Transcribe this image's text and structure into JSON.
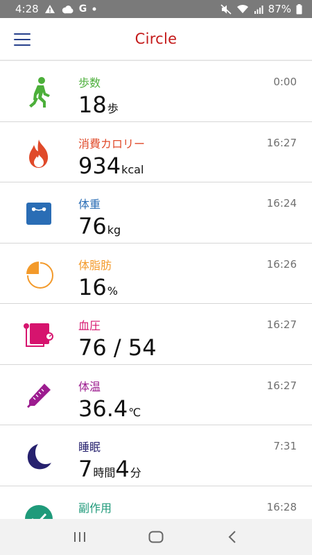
{
  "status_bar": {
    "time": "4:28",
    "battery": "87%",
    "left_icons": [
      "warning-icon",
      "cloud-icon",
      "g-icon",
      "dot-icon"
    ],
    "right_icons": [
      "mute-icon",
      "wifi-icon",
      "signal-icon",
      "battery-icon"
    ],
    "g_label": "G"
  },
  "app_bar": {
    "title": "Circle",
    "title_color": "#c41a1a",
    "menu_color": "#26408b"
  },
  "rows": [
    {
      "label": "歩数",
      "time": "0:00",
      "value": "18",
      "unit": "歩",
      "icon": "walking-person-icon",
      "color": "#4caf3a"
    },
    {
      "label": "消費カロリー",
      "time": "16:27",
      "value": "934",
      "unit": "kcal",
      "icon": "flame-icon",
      "color": "#e04a2a"
    },
    {
      "label": "体重",
      "time": "16:24",
      "value": "76",
      "unit": "kg",
      "icon": "scale-icon",
      "color": "#2a6db5"
    },
    {
      "label": "体脂肪",
      "time": "16:26",
      "value": "16",
      "unit": "%",
      "icon": "pie-chart-icon",
      "color": "#f39a2b"
    },
    {
      "label": "血圧",
      "time": "16:27",
      "value": "76 / 54",
      "unit": "",
      "icon": "blood-pressure-monitor-icon",
      "color": "#d6146e"
    },
    {
      "label": "体温",
      "time": "16:27",
      "value": "36.4",
      "unit": "℃",
      "icon": "thermometer-icon",
      "color": "#9c1c8f"
    },
    {
      "label": "睡眠",
      "time": "7:31",
      "value_h": "7",
      "unit_h": "時間",
      "value_m": "4",
      "unit_m": "分",
      "icon": "crescent-moon-icon",
      "color": "#26216e"
    },
    {
      "label": "副作用",
      "time": "16:28",
      "value": "",
      "unit": "",
      "icon": "check-circle-icon",
      "color": "#1f9a7a"
    }
  ],
  "nav_bar": {
    "buttons": [
      "recent-apps-icon",
      "home-icon",
      "back-icon"
    ]
  }
}
